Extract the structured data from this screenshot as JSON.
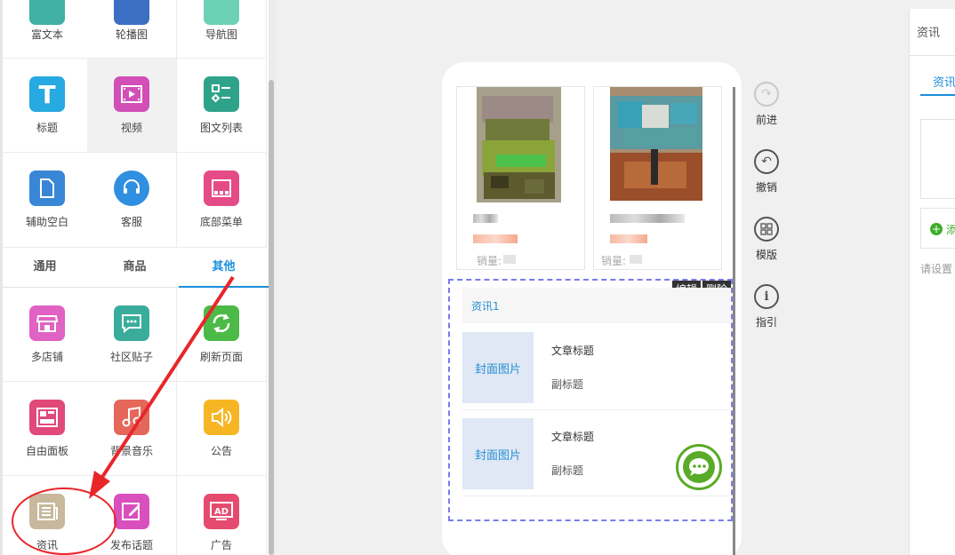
{
  "left_panel": {
    "top_row": [
      {
        "label": "富文本",
        "icon": "richtext-icon",
        "color": "#3fb0a3"
      },
      {
        "label": "轮播图",
        "icon": "carousel-icon",
        "color": "#3a6fc4"
      },
      {
        "label": "导航图",
        "icon": "nav-image-icon",
        "color": "#6dd1b5"
      }
    ],
    "row2": [
      {
        "label": "标题",
        "icon": "title-T-icon",
        "color": "#27a9e1"
      },
      {
        "label": "视频",
        "icon": "video-icon",
        "color": "#d14fb7"
      },
      {
        "label": "图文列表",
        "icon": "image-text-list-icon",
        "color": "#2fa38a"
      }
    ],
    "row3": [
      {
        "label": "辅助空白",
        "icon": "blank-doc-icon",
        "color": "#3a86d6"
      },
      {
        "label": "客服",
        "icon": "headset-icon",
        "color": "#2f8fe0"
      },
      {
        "label": "底部菜单",
        "icon": "bottom-menu-icon",
        "color": "#e54b86"
      }
    ],
    "tabs": [
      {
        "label": "通用",
        "active": false
      },
      {
        "label": "商品",
        "active": false
      },
      {
        "label": "其他",
        "active": true
      }
    ],
    "row4": [
      {
        "label": "多店铺",
        "icon": "multi-store-icon",
        "color": "#e062c3"
      },
      {
        "label": "社区贴子",
        "icon": "community-post-icon",
        "color": "#3aac9c"
      },
      {
        "label": "刷新页面",
        "icon": "refresh-icon",
        "color": "#4cba47"
      }
    ],
    "row5": [
      {
        "label": "自由面板",
        "icon": "free-panel-icon",
        "color": "#e0497a"
      },
      {
        "label": "背景音乐",
        "icon": "music-note-icon",
        "color": "#e5675a"
      },
      {
        "label": "公告",
        "icon": "speaker-icon",
        "color": "#f6b623"
      }
    ],
    "row6": [
      {
        "label": "资讯",
        "icon": "news-icon",
        "color": "#c8b89c"
      },
      {
        "label": "发布话题",
        "icon": "publish-topic-icon",
        "color": "#d94fbd"
      },
      {
        "label": "广告",
        "icon": "ad-icon",
        "color": "#e54b6f"
      }
    ]
  },
  "preview": {
    "products": [
      {
        "sales_label": "销量:"
      },
      {
        "sales_label": "销量:"
      }
    ],
    "news_block": {
      "title": "资讯1",
      "edit_label": "编辑",
      "delete_label": "删除",
      "articles": [
        {
          "cover": "封面图片",
          "title": "文章标题",
          "subtitle": "副标题"
        },
        {
          "cover": "封面图片",
          "title": "文章标题",
          "subtitle": "副标题"
        }
      ]
    }
  },
  "toolbar": {
    "forward": "前进",
    "undo": "撤销",
    "template": "模版",
    "guide": "指引"
  },
  "right_panel": {
    "title": "资讯",
    "tab": "资讯",
    "add_label": "添",
    "hint": "请设置"
  },
  "colors": {
    "accent": "#1a8fdb",
    "annotation": "#e8262a",
    "chat": "#5aab27"
  }
}
